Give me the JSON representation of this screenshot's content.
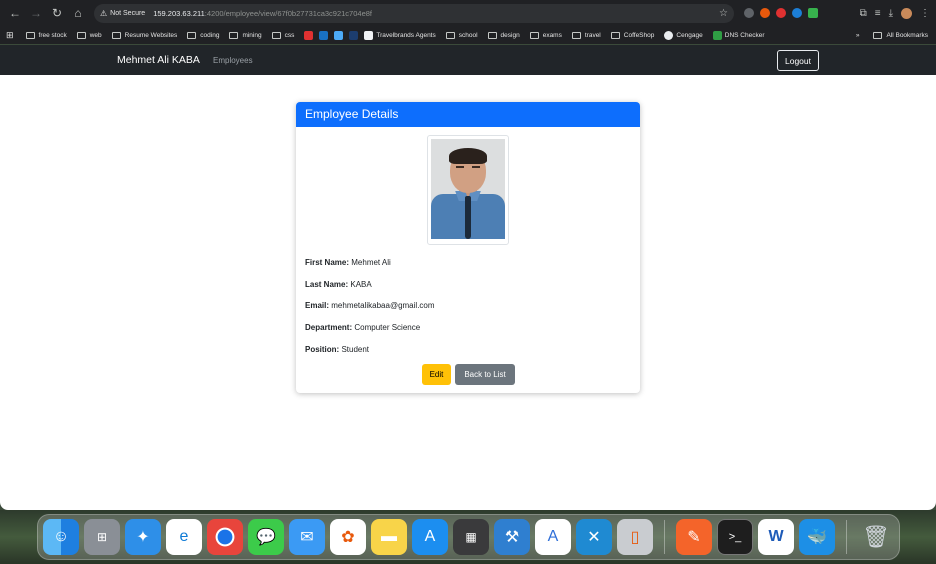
{
  "browser": {
    "not_secure_label": "Not Secure",
    "url_host": "159.203.63.211",
    "url_path": ":4200/employee/view/67f0b27731ca3c921c704e8f",
    "bookmarks": [
      {
        "label": "free stock",
        "type": "folder"
      },
      {
        "label": "web",
        "type": "folder"
      },
      {
        "label": "Resume Websites",
        "type": "folder"
      },
      {
        "label": "coding",
        "type": "folder"
      },
      {
        "label": "mining",
        "type": "folder"
      },
      {
        "label": "css",
        "type": "folder"
      },
      {
        "label": "Travelbrands Agents",
        "type": "site"
      },
      {
        "label": "school",
        "type": "folder"
      },
      {
        "label": "design",
        "type": "folder"
      },
      {
        "label": "exams",
        "type": "folder"
      },
      {
        "label": "travel",
        "type": "folder"
      },
      {
        "label": "CoffeShop",
        "type": "folder"
      },
      {
        "label": "Cengage",
        "type": "site"
      },
      {
        "label": "DNS Checker",
        "type": "site"
      }
    ],
    "all_bookmarks_label": "All Bookmarks"
  },
  "navbar": {
    "brand": "Mehmet Ali KABA",
    "link_employees": "Employees",
    "logout": "Logout"
  },
  "card": {
    "title": "Employee Details",
    "fields": [
      {
        "label": "First Name:",
        "value": "Mehmet Ali"
      },
      {
        "label": "Last Name:",
        "value": "KABA"
      },
      {
        "label": "Email:",
        "value": "mehmetalikabaa@gmail.com"
      },
      {
        "label": "Department:",
        "value": "Computer Science"
      },
      {
        "label": "Position:",
        "value": "Student"
      }
    ],
    "edit_label": "Edit",
    "back_label": "Back to List"
  },
  "colors": {
    "primary": "#0d6efd",
    "warning": "#ffc107",
    "secondary": "#6c757d",
    "navbar": "#212529"
  },
  "dock": {
    "apps": [
      "finder-icon",
      "launchpad-icon",
      "safari-icon",
      "edge-icon",
      "chrome-icon",
      "messages-icon",
      "mail-icon",
      "photos-icon",
      "notes-icon",
      "app-store-icon",
      "calculator-icon",
      "xcode-icon",
      "instruments-icon",
      "vscode-icon",
      "simulator-icon",
      "pen-tool-icon",
      "terminal-icon",
      "word-icon",
      "docker-icon",
      "trash-icon"
    ]
  }
}
